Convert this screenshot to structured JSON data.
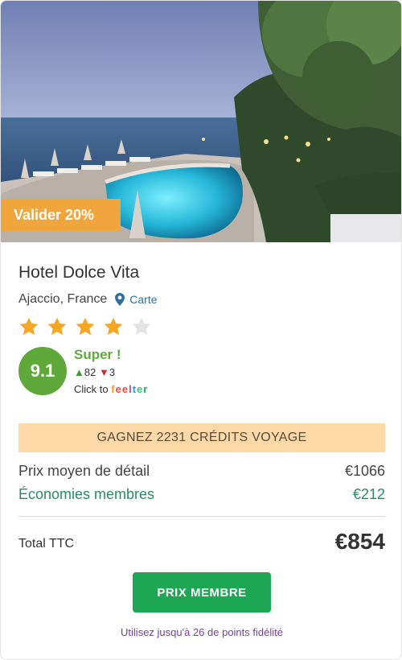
{
  "offer": {
    "badge_label": "Valider 20%",
    "hotel_name": "Hotel Dolce Vita",
    "location": "Ajaccio, France",
    "map_link": "Carte",
    "star_rating": 4,
    "star_max": 5,
    "accent_color": "#f0a63c"
  },
  "review": {
    "score": "9.1",
    "label": "Super !",
    "up_arrow": "▲",
    "up_votes": "82",
    "down_arrow": "▼",
    "down_votes": "3",
    "click_to": "Click to",
    "brand_letters": [
      "f",
      "e",
      "e",
      "l",
      "t",
      "e",
      "r"
    ],
    "score_color": "#5fa93b"
  },
  "credits": {
    "banner": "GAGNEZ 2231 CRÉDITS VOYAGE"
  },
  "pricing": {
    "retail_label": "Prix moyen de détail",
    "retail_value": "€1066",
    "savings_label": "Économies membres",
    "savings_value": "€212",
    "total_label": "Total TTC",
    "total_value": "€854"
  },
  "actions": {
    "cta_label": "PRIX MEMBRE",
    "cta_color": "#1da653",
    "loyalty_note": "Utilisez jusqu'à 26 de points fidélité"
  }
}
